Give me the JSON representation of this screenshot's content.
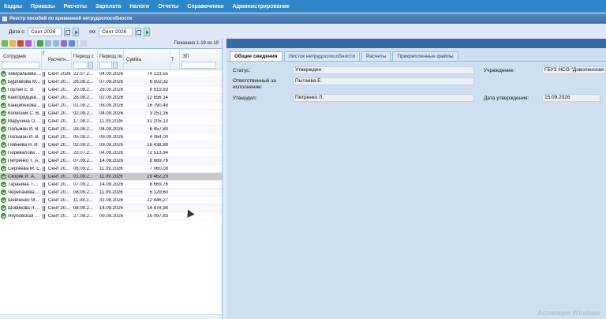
{
  "menu": [
    "Кадры",
    "Приказы",
    "Расчеты",
    "Зарплата",
    "Налоги",
    "Отчеты",
    "Справочники",
    "Администрирование"
  ],
  "window": {
    "title": "Реестр пособий по временной нетрудоспособности"
  },
  "filter": {
    "date_from_label": "Дата с:",
    "date_from": "Сент 2026",
    "date_to_label": "по:",
    "date_to": "Сент 2026"
  },
  "grid": {
    "shown": "Показано 1-19 из 19",
    "columns": [
      "Сотрудник",
      "Г",
      "Расчетн...",
      "Период с",
      "Период по",
      "Сумма",
      "Т",
      "ЭП"
    ],
    "rows": [
      [
        "Амиралыева ...",
        "Сент 2026",
        "22.07.2...",
        "04.09.2026",
        "74 123,55"
      ],
      [
        "Бурлакова М...",
        "Сент 20...",
        "26.08.2...",
        "07.09.2026",
        "6 502,32"
      ],
      [
        "Горлач Е. В.",
        "Сент 20...",
        "20.08.2...",
        "28.08.2026",
        "9 619,83"
      ],
      [
        "Кайгородцев...",
        "Сент 20...",
        "28.08.2...",
        "02.09.2026",
        "12 856,14"
      ],
      [
        "Канцибекова ...",
        "Сент 20...",
        "01.09.2...",
        "08.09.2026",
        "16 790,48"
      ],
      [
        "Колесник С. В.",
        "Сент 20...",
        "02.09.2...",
        "04.09.2026",
        "3 251,16"
      ],
      [
        "Марухина О....",
        "Сент 20...",
        "17.08.2...",
        "11.09.2026",
        "31 205,13"
      ],
      [
        "Пальман И. В.",
        "Сент 20...",
        "28.08.2...",
        "04.09.2026",
        "6 457,80"
      ],
      [
        "Пальман И. В.",
        "Сент 20...",
        "05.09.2...",
        "09.09.2026",
        "4 064,00"
      ],
      [
        "Певнева Н. И.",
        "Сент 20...",
        "02.09.2...",
        "09.09.2026",
        "18 438,88"
      ],
      [
        "Перевалова ...",
        "Сент 20...",
        "23.07.2...",
        "04.09.2026",
        "72 513,84"
      ],
      [
        "Петренко Т. А.",
        "Сент 20...",
        "07.09.2...",
        "14.09.2026",
        "8 669,76"
      ],
      [
        "Сергеева М. С.",
        "Сент 20...",
        "08.09.2...",
        "11.09.2026",
        "7 060,08"
      ],
      [
        "Скорик И. А.",
        "Сент 20...",
        "01.09.2...",
        "11.09.2026",
        "29 462,29"
      ],
      [
        "Таранина Т....",
        "Сент 20...",
        "07.09.2...",
        "14.09.2026",
        "8 669,76"
      ],
      [
        "Черепанова ...",
        "Сент 20...",
        "08.09.2...",
        "11.09.2026",
        "5 129,60"
      ],
      [
        "Шевченко М...",
        "Сент 20...",
        "11.08.2...",
        "31.08.2026",
        "22 446,27"
      ],
      [
        "Шовикова Л....",
        "Сент 20...",
        "08.09.2...",
        "14.09.2026",
        "14 478,94"
      ],
      [
        "Якубовская ...",
        "Сент 20...",
        "27.08.2...",
        "09.09.2026",
        "15 097,83"
      ]
    ],
    "selected_index": 13
  },
  "details": {
    "tabs": [
      "Общие сведения",
      "Листок нетрудоспособности",
      "Расчеты",
      "Прикрепленные файлы"
    ],
    "active_tab": 0,
    "status_label": "Статус:",
    "status_value": "Утвержден",
    "responsible_label_1": "Ответственный за",
    "responsible_label_2": "исполнение:",
    "responsible_value": "Пытаева Е.",
    "approved_by_label": "Утвердил:",
    "approved_by_value": "Петренко Л.",
    "institution_label": "Учреждение:",
    "institution_value": "ГБУЗ НСО \"Доволенская",
    "approval_date_label": "Дата утверждения:",
    "approval_date_value": "15.09.2026"
  },
  "watermark": "Активация Windows",
  "colors": {
    "menu_bg": "#2f86c8",
    "selected_row": "#c9c9c9",
    "panel_bg": "#cfdfef",
    "ok_icon": "#4aa43a"
  }
}
